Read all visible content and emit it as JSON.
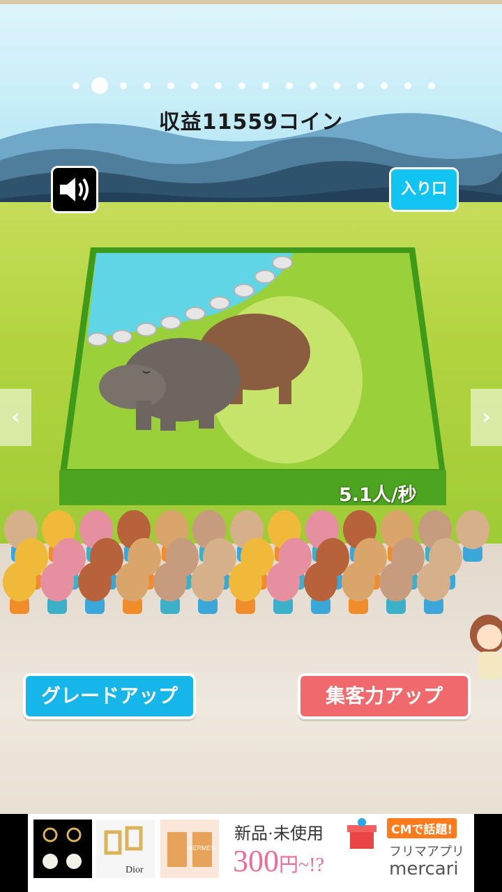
{
  "pager": {
    "count": 16,
    "active_index": 1
  },
  "income_label": "収益11559コイン",
  "sound_icon": "speaker-icon",
  "entrance_label": "入り口",
  "rate_label": "5.1人/秒",
  "nav": {
    "prev": "‹",
    "next": "›"
  },
  "buttons": {
    "upgrade": "グレードアップ",
    "attract": "集客力アップ"
  },
  "ad": {
    "headline": "新品·未使用",
    "price": "300",
    "price_suffix": "円~!?",
    "badge": "CMで話題!",
    "subtitle": "フリマアプリ",
    "brand": "mercari",
    "thumb_brands": [
      "",
      "Dior",
      "HERMES"
    ]
  },
  "colors": {
    "accent_blue": "#16b6ea",
    "accent_red": "#f06a6d",
    "grass": "#a7cf3a"
  }
}
